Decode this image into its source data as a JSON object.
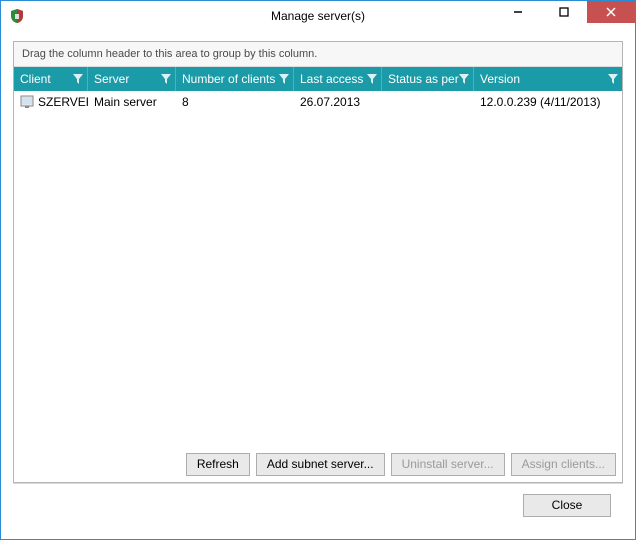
{
  "window": {
    "title": "Manage server(s)"
  },
  "grid": {
    "group_hint": "Drag the column header to this area to group by this column.",
    "columns": {
      "c0": "Client",
      "c1": "Server",
      "c2": "Number of clients",
      "c3": "Last access",
      "c4": "Status as per",
      "c5": "Version"
    },
    "rows": [
      {
        "client": "SZERVER",
        "server": "Main server",
        "num_clients": "8",
        "last_access": "26.07.2013",
        "status_as_per": "",
        "version": "12.0.0.239 (4/11/2013)"
      }
    ]
  },
  "buttons": {
    "refresh": "Refresh",
    "add_subnet": "Add subnet server...",
    "uninstall": "Uninstall server...",
    "assign": "Assign clients...",
    "close": "Close"
  }
}
